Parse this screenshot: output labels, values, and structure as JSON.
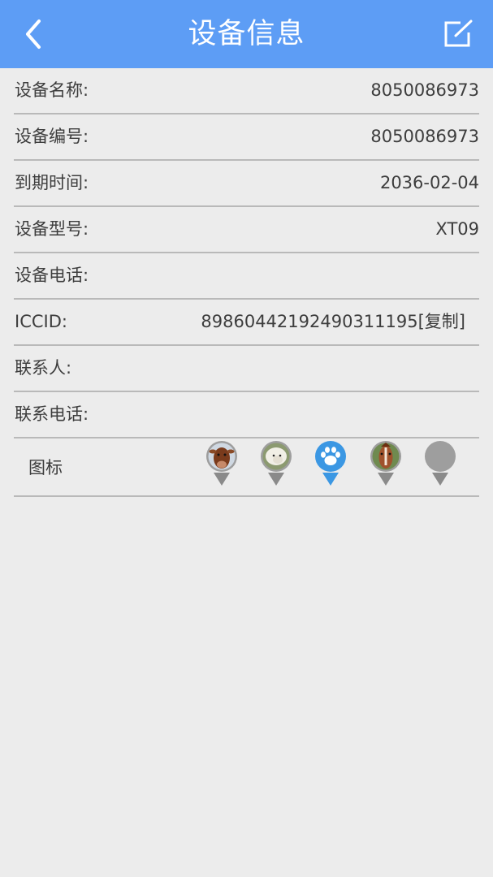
{
  "header": {
    "title": "设备信息",
    "bar_color": "#5d9df5"
  },
  "rows": [
    {
      "label": "设备名称:",
      "value": "8050086973"
    },
    {
      "label": "设备编号:",
      "value": "8050086973"
    },
    {
      "label": "到期时间:",
      "value": "2036-02-04"
    },
    {
      "label": "设备型号:",
      "value": "XT09"
    },
    {
      "label": "设备电话:",
      "value": ""
    },
    {
      "label": "ICCID:",
      "value": "89860442192490311195",
      "copy_label": "[复制]"
    },
    {
      "label": "联系人:",
      "value": ""
    },
    {
      "label": "联系电话:",
      "value": ""
    }
  ],
  "icon_picker": {
    "label": "图标",
    "options": [
      "cow-icon",
      "sheep-icon",
      "paw-icon",
      "horse-icon",
      "default-icon"
    ],
    "selected": "paw-icon",
    "selected_color": "#3b97e3"
  }
}
